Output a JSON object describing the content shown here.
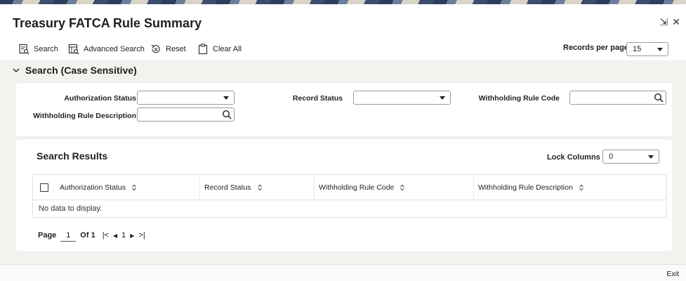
{
  "header": {
    "title": "Treasury FATCA Rule Summary"
  },
  "window_controls": {
    "collapse": "⇲",
    "close": "✕"
  },
  "toolbar": {
    "search": "Search",
    "advanced_search": "Advanced Search",
    "reset": "Reset",
    "clear_all": "Clear All",
    "records_per_page_label": "Records per page",
    "records_per_page_value": "15"
  },
  "search_section": {
    "title": "Search (Case Sensitive)",
    "fields": {
      "authorization_status_label": "Authorization Status",
      "authorization_status_value": "",
      "record_status_label": "Record Status",
      "record_status_value": "",
      "withholding_rule_code_label": "Withholding Rule Code",
      "withholding_rule_code_value": "",
      "withholding_rule_description_label": "Withholding Rule Description",
      "withholding_rule_description_value": ""
    }
  },
  "results": {
    "title": "Search Results",
    "lock_columns_label": "Lock Columns",
    "lock_columns_value": "0",
    "columns": [
      "Authorization Status",
      "Record Status",
      "Withholding Rule Code",
      "Withholding Rule Description"
    ],
    "empty_message": "No data to display.",
    "pagination": {
      "page_label": "Page",
      "current_page": "1",
      "of_label": "Of 1",
      "first": "|<",
      "prev": "◀",
      "page_number": "1",
      "next": "▶",
      "last": ">|"
    }
  },
  "footer": {
    "exit": "Exit"
  }
}
